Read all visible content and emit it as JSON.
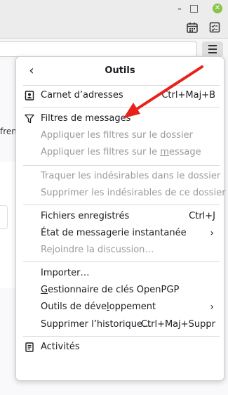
{
  "panel": {
    "title": "Outils",
    "items": [
      {
        "label": "Carnet d’adresses",
        "shortcut": "Ctrl+Maj+B",
        "disabled": false,
        "icon": "address-book-icon"
      },
      {
        "label": "Filtres de messages",
        "shortcut": "",
        "disabled": false,
        "icon": "filter-icon"
      },
      {
        "label": "Appliquer les filtres sur le dossier",
        "shortcut": "",
        "disabled": true
      },
      {
        "label_a": "Appliquer les filtres sur le ",
        "label_u": "m",
        "label_b": "essage",
        "shortcut": "",
        "disabled": true
      },
      {
        "label": "Traquer les indésirables dans le dossier",
        "shortcut": "",
        "disabled": true
      },
      {
        "label": "Supprimer les indésirables de ce dossier",
        "shortcut": "",
        "disabled": true
      },
      {
        "label": "Fichiers enregistrés",
        "shortcut": "Ctrl+J",
        "disabled": false
      },
      {
        "label": "État de messagerie instantanée",
        "shortcut": "",
        "disabled": false,
        "submenu": true
      },
      {
        "label": "Rejoindre la discussion…",
        "shortcut": "",
        "disabled": true
      },
      {
        "label": "Importer…",
        "shortcut": "",
        "disabled": false
      },
      {
        "label_u": "G",
        "label_b": "estionnaire de clés OpenPGP",
        "shortcut": "",
        "disabled": false
      },
      {
        "label_a": "Outils de déve",
        "label_u": "l",
        "label_b": "oppement",
        "shortcut": "",
        "disabled": false,
        "submenu": true
      },
      {
        "label": "Supprimer l’historique…",
        "shortcut": "Ctrl+Maj+Suppr",
        "disabled": false
      },
      {
        "label": "Activités",
        "shortcut": "",
        "disabled": false,
        "icon": "activity-icon"
      }
    ]
  },
  "background": {
    "partial_text": "fren"
  },
  "annotation": {
    "arrow_color": "#e8211a"
  },
  "colors": {
    "close_button": "#8bc34a",
    "disabled_text": "#9a9a9f"
  }
}
